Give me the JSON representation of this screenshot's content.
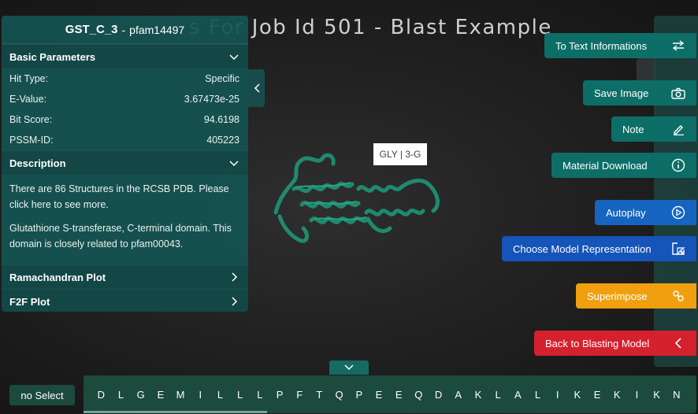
{
  "page_title": "s For Job Id 501 - Blast Example",
  "panel": {
    "title": "GST_C_3",
    "subtitle": "pfam14497",
    "sep": "-",
    "basic": {
      "heading": "Basic Parameters",
      "rows": [
        {
          "label": "Hit Type:",
          "value": "Specific"
        },
        {
          "label": "E-Value:",
          "value": "3.67473e-25"
        },
        {
          "label": "Bit Score:",
          "value": "94.6198"
        },
        {
          "label": "PSSM-ID:",
          "value": "405223"
        }
      ]
    },
    "description": {
      "heading": "Description",
      "p1": "There are 86 Structures in the RCSB PDB. Please click here to see more.",
      "p2": "Glutathione S-transferase, C-terminal domain. This domain is closely related to pfam00043."
    },
    "ramachandran": "Ramachandran Plot",
    "f2f": "F2F Plot"
  },
  "tooltip": "GLY | 3-G",
  "actions": {
    "text_info": "To Text Informations",
    "save_image": "Save Image",
    "note": "Note",
    "material_download": "Material Download",
    "autoplay": "Autoplay",
    "choose_model": "Choose Model Representation",
    "superimpose": "Superimpose",
    "back": "Back to Blasting Model"
  },
  "no_select": "no Select",
  "sequence": [
    "D",
    "L",
    "G",
    "E",
    "M",
    "I",
    "L",
    "L",
    "L",
    "P",
    "F",
    "T",
    "Q",
    "P",
    "E",
    "E",
    "Q",
    "D",
    "A",
    "K",
    "L",
    "A",
    "L",
    "I",
    "K",
    "E",
    "K",
    "I",
    "K",
    "N"
  ],
  "sequence_progress": 0.3,
  "colors": {
    "panel": "#165452",
    "teal": "#0d6e67",
    "blue": "#1565c0",
    "orange": "#f0a00e",
    "red": "#d5202e",
    "ribbon": "#1f8a6e"
  }
}
